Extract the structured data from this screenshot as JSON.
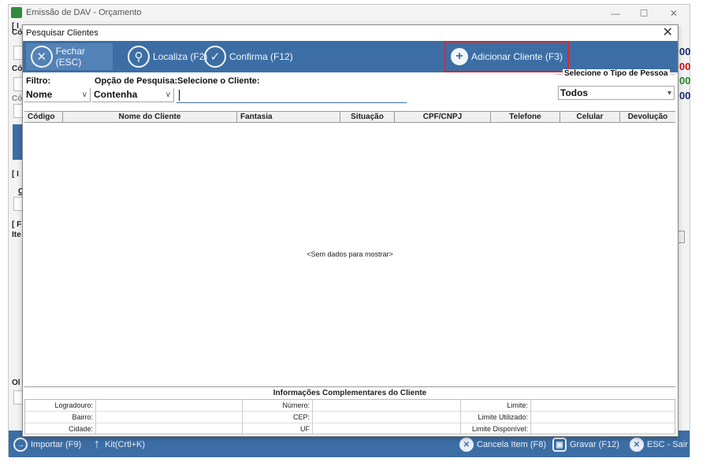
{
  "background_window": {
    "title": "Emissão de DAV - Orçamento",
    "controls": {
      "minimize": "—",
      "maximize": "☐",
      "close": "✕"
    },
    "fragments": [
      "[ I",
      "Có",
      "Có",
      "Có",
      "[ I",
      "C",
      "[ F",
      "Ite",
      "Ol"
    ],
    "right_values": [
      "00",
      "00",
      "00",
      "00"
    ],
    "bottom_bar": {
      "importar": "Importar (F9)",
      "kit": "Kit(Crtl+K)",
      "cancela": "Cancela Item (F8)",
      "gravar": "Gravar (F12)",
      "sair": "ESC - Sair"
    }
  },
  "dialog": {
    "title": "Pesquisar Clientes",
    "close_glyph": "✕",
    "toolbar": {
      "fechar": "Fechar (ESC)",
      "localiza": "Localiza (F2)",
      "confirma": "Confirma (F12)",
      "adicionar": "Adicionar Cliente (F3)"
    },
    "filters": {
      "filtro_label": "Filtro:",
      "filtro_value": "Nome",
      "opcao_label": "Opção de Pesquisa:",
      "opcao_value": "Contenha",
      "selecione_label": "Selecione o Cliente:",
      "search_value": "",
      "tipo_label": "Selecione o Tipo de Pessoa",
      "tipo_value": "Todos"
    },
    "grid": {
      "columns": [
        "Código",
        "Nome do Cliente",
        "Fantasia",
        "Situação",
        "CPF/CNPJ",
        "Telefone",
        "Celular",
        "Devolução"
      ],
      "empty_text": "<Sem dados para mostrar>"
    },
    "info": {
      "title": "Informações Complementares do Cliente",
      "col1": [
        "Logradouro:",
        "Bairro:",
        "Cidade:"
      ],
      "col2": [
        "Número:",
        "CEP:",
        "UF"
      ],
      "col3": [
        "Limite:",
        "Limite Utilizado:",
        "Limite Disponível:"
      ]
    }
  },
  "colors": {
    "toolbar_blue": "#3c6ea5",
    "highlight_red": "#e0242c",
    "value_green": "#1f8a1f",
    "value_red": "#d01010",
    "value_navy": "#1a2a7a"
  }
}
